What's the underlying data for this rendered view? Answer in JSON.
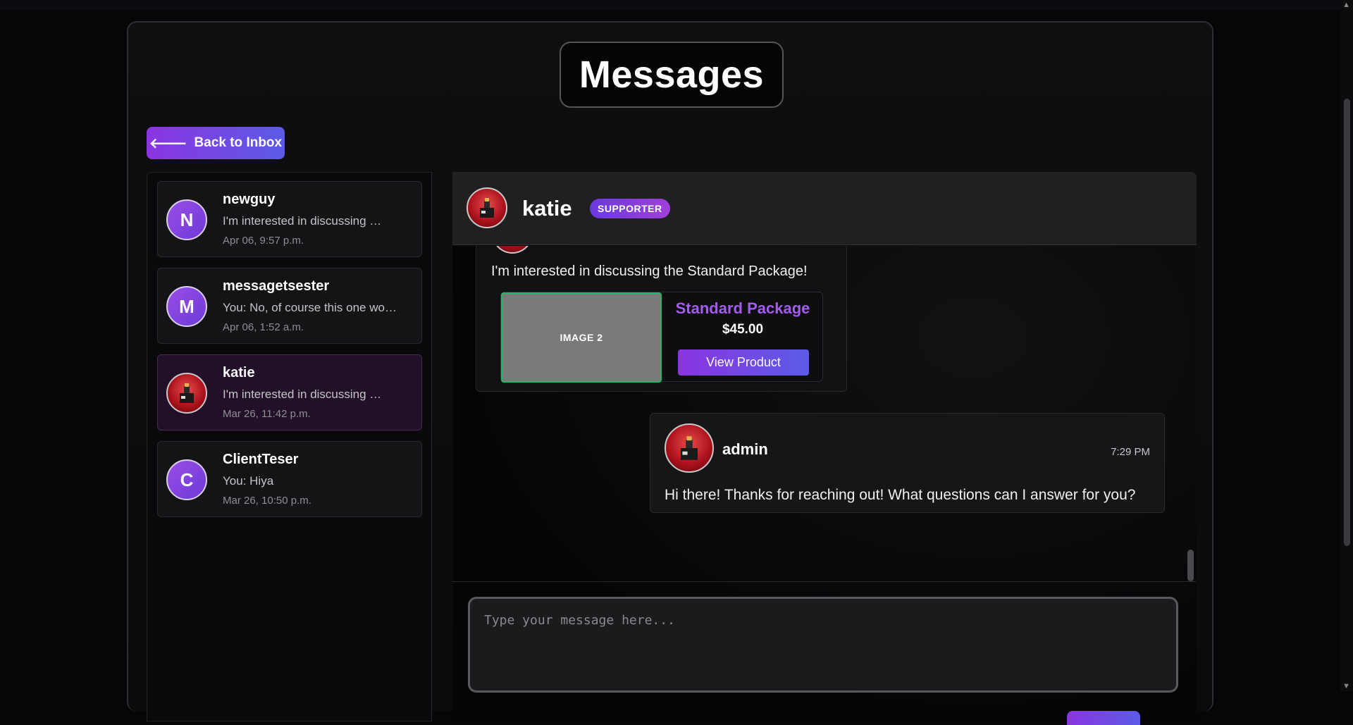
{
  "page": {
    "title": "Messages"
  },
  "back_button": {
    "label": "Back to Inbox"
  },
  "conversations": [
    {
      "name": "newguy",
      "initial": "N",
      "preview": "I'm interested in discussing …",
      "time": "Apr 06, 9:57 p.m."
    },
    {
      "name": "messagetsester",
      "initial": "M",
      "preview": "You: No, of course this one wo…",
      "time": "Apr 06, 1:52 a.m."
    },
    {
      "name": "katie",
      "initial": "",
      "preview": "I'm interested in discussing …",
      "time": "Mar 26, 11:42 p.m.",
      "active": true
    },
    {
      "name": "ClientTeser",
      "initial": "C",
      "preview": "You: Hiya",
      "time": "Mar 26, 10:50 p.m."
    }
  ],
  "chat": {
    "contact_name": "katie",
    "badge": "SUPPORTER",
    "messages": [
      {
        "text": "I'm interested in discussing the Standard Package!",
        "product": {
          "image_label": "IMAGE 2",
          "name": "Standard Package",
          "price": "$45.00",
          "button_label": "View Product"
        }
      },
      {
        "sender": "admin",
        "time": "7:29 PM",
        "text": "Hi there! Thanks for reaching out! What questions can I answer for you?"
      }
    ],
    "input": {
      "placeholder": "Type your message here...",
      "value": ""
    }
  },
  "colors": {
    "accent_start": "#8b35e0",
    "accent_end": "#5b5be6",
    "product_name": "#a45cf0",
    "image_border": "#1fb868",
    "active_conversation": "#221028"
  }
}
